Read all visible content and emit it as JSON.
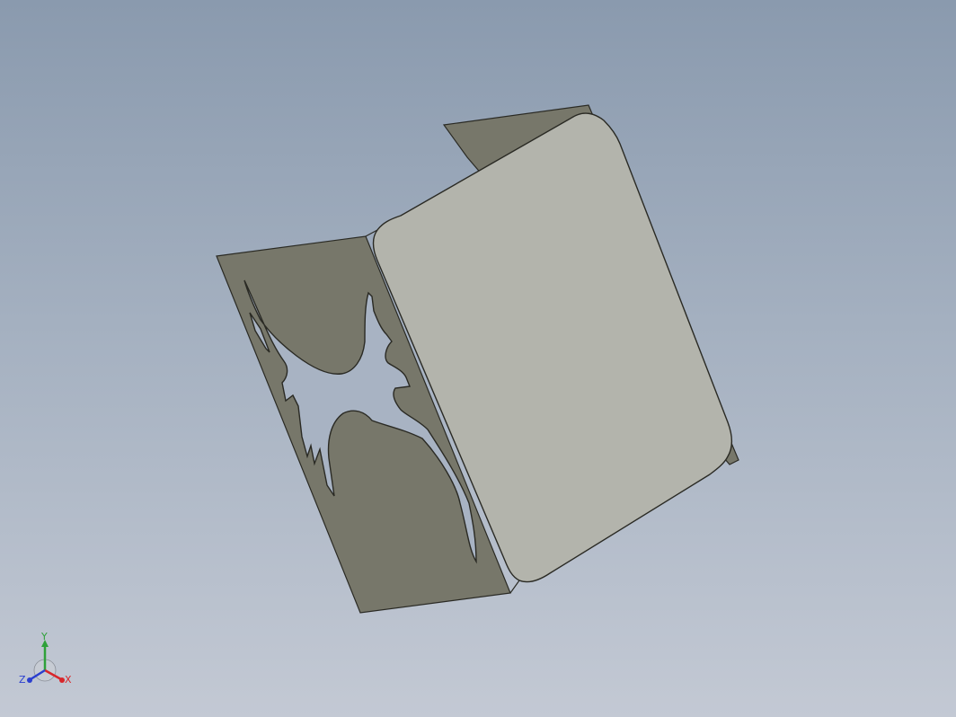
{
  "viewport": {
    "background_top": "#8a9aae",
    "background_bottom": "#c3c9d4"
  },
  "model": {
    "panel_face_color": "#b3b4ac",
    "panel_side_color": "#77776a",
    "edge_color": "#2a2a24"
  },
  "triad": {
    "x_label": "X",
    "y_label": "Y",
    "z_label": "Z",
    "x_color": "#d8262b",
    "y_color": "#2fa13a",
    "z_color": "#2b3fcf"
  }
}
